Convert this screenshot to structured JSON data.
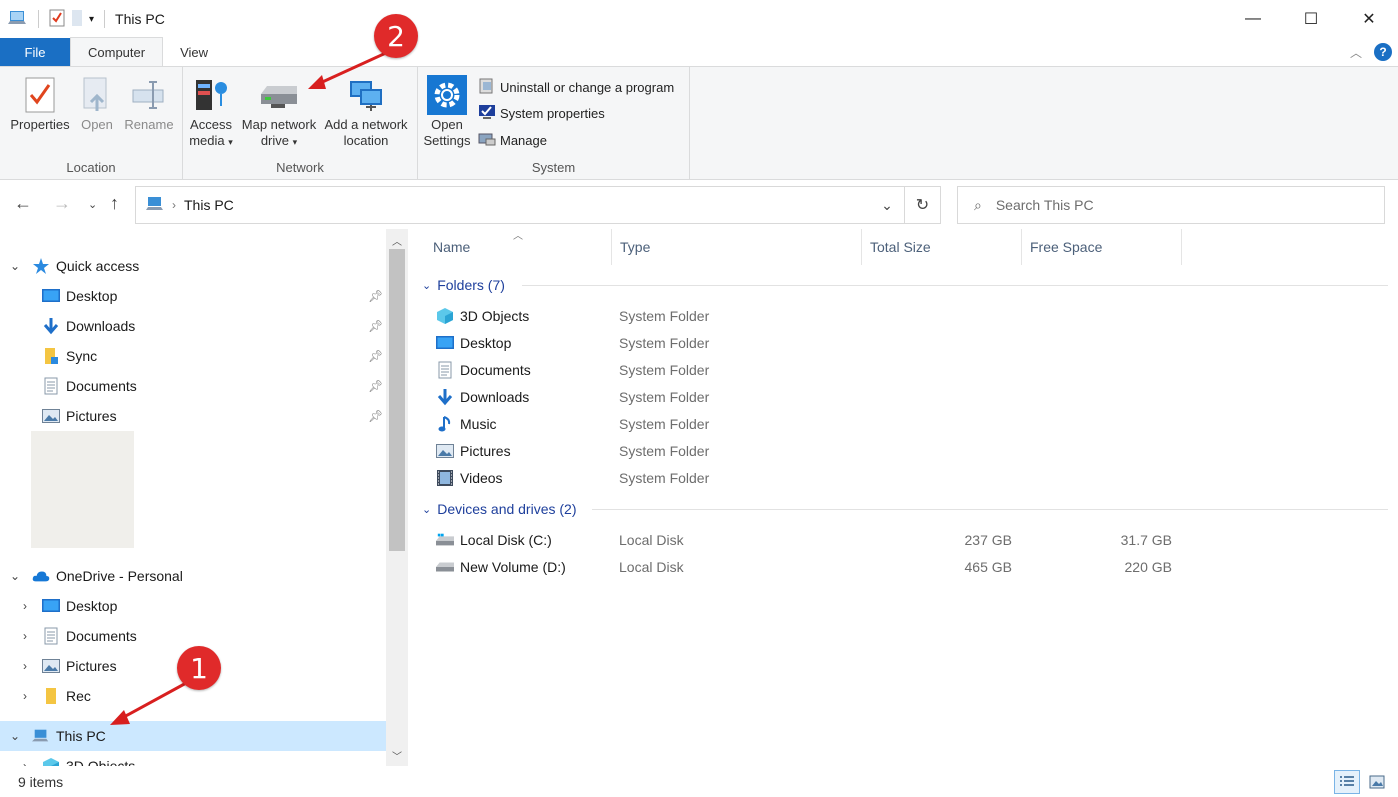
{
  "window": {
    "title": "This PC",
    "controls": [
      "minimize-icon",
      "maximize-icon",
      "close-icon"
    ]
  },
  "ribbon_tabs": [
    {
      "label": "File"
    },
    {
      "label": "Computer"
    },
    {
      "label": "View"
    }
  ],
  "ribbon": {
    "groups": {
      "location": {
        "label": "Location",
        "buttons": {
          "properties": "Properties",
          "open": "Open",
          "rename": "Rename"
        }
      },
      "network": {
        "label": "Network",
        "buttons": {
          "access_media_1": "Access",
          "access_media_2": "media",
          "map_drive_1": "Map network",
          "map_drive_2": "drive",
          "add_location_1": "Add a network",
          "add_location_2": "location"
        }
      },
      "system": {
        "label": "System",
        "buttons": {
          "open_settings_1": "Open",
          "open_settings_2": "Settings",
          "uninstall": "Uninstall or change a program",
          "system_properties": "System properties",
          "manage": "Manage"
        }
      }
    }
  },
  "address": {
    "path": "This PC",
    "search_placeholder": "Search This PC"
  },
  "nav_tree": {
    "quick_access": {
      "label": "Quick access",
      "items": [
        "Desktop",
        "Downloads",
        "Sync",
        "Documents",
        "Pictures"
      ]
    },
    "onedrive": {
      "label": "OneDrive - Personal",
      "items": [
        "Desktop",
        "Documents",
        "Pictures",
        "Rec"
      ]
    },
    "this_pc": {
      "label": "This PC",
      "first_child": "3D Objects"
    }
  },
  "columns": [
    "Name",
    "Type",
    "Total Size",
    "Free Space"
  ],
  "folders_group": {
    "label": "Folders (7)",
    "items": [
      {
        "name": "3D Objects",
        "type": "System Folder",
        "icon": "3d-objects-icon"
      },
      {
        "name": "Desktop",
        "type": "System Folder",
        "icon": "desktop-folder-icon"
      },
      {
        "name": "Documents",
        "type": "System Folder",
        "icon": "documents-folder-icon"
      },
      {
        "name": "Downloads",
        "type": "System Folder",
        "icon": "downloads-folder-icon"
      },
      {
        "name": "Music",
        "type": "System Folder",
        "icon": "music-folder-icon"
      },
      {
        "name": "Pictures",
        "type": "System Folder",
        "icon": "pictures-folder-icon"
      },
      {
        "name": "Videos",
        "type": "System Folder",
        "icon": "videos-folder-icon"
      }
    ]
  },
  "drives_group": {
    "label": "Devices and drives (2)",
    "items": [
      {
        "name": "Local Disk (C:)",
        "type": "Local Disk",
        "total": "237 GB",
        "free": "31.7 GB"
      },
      {
        "name": "New Volume (D:)",
        "type": "Local Disk",
        "total": "465 GB",
        "free": "220 GB"
      }
    ]
  },
  "status": {
    "items_count": "9 items"
  },
  "annotations": {
    "badge_1": "1",
    "badge_2": "2"
  },
  "colors": {
    "accent": "#1a6fc4",
    "selection": "#cce8ff",
    "badge": "#e02a2a"
  }
}
